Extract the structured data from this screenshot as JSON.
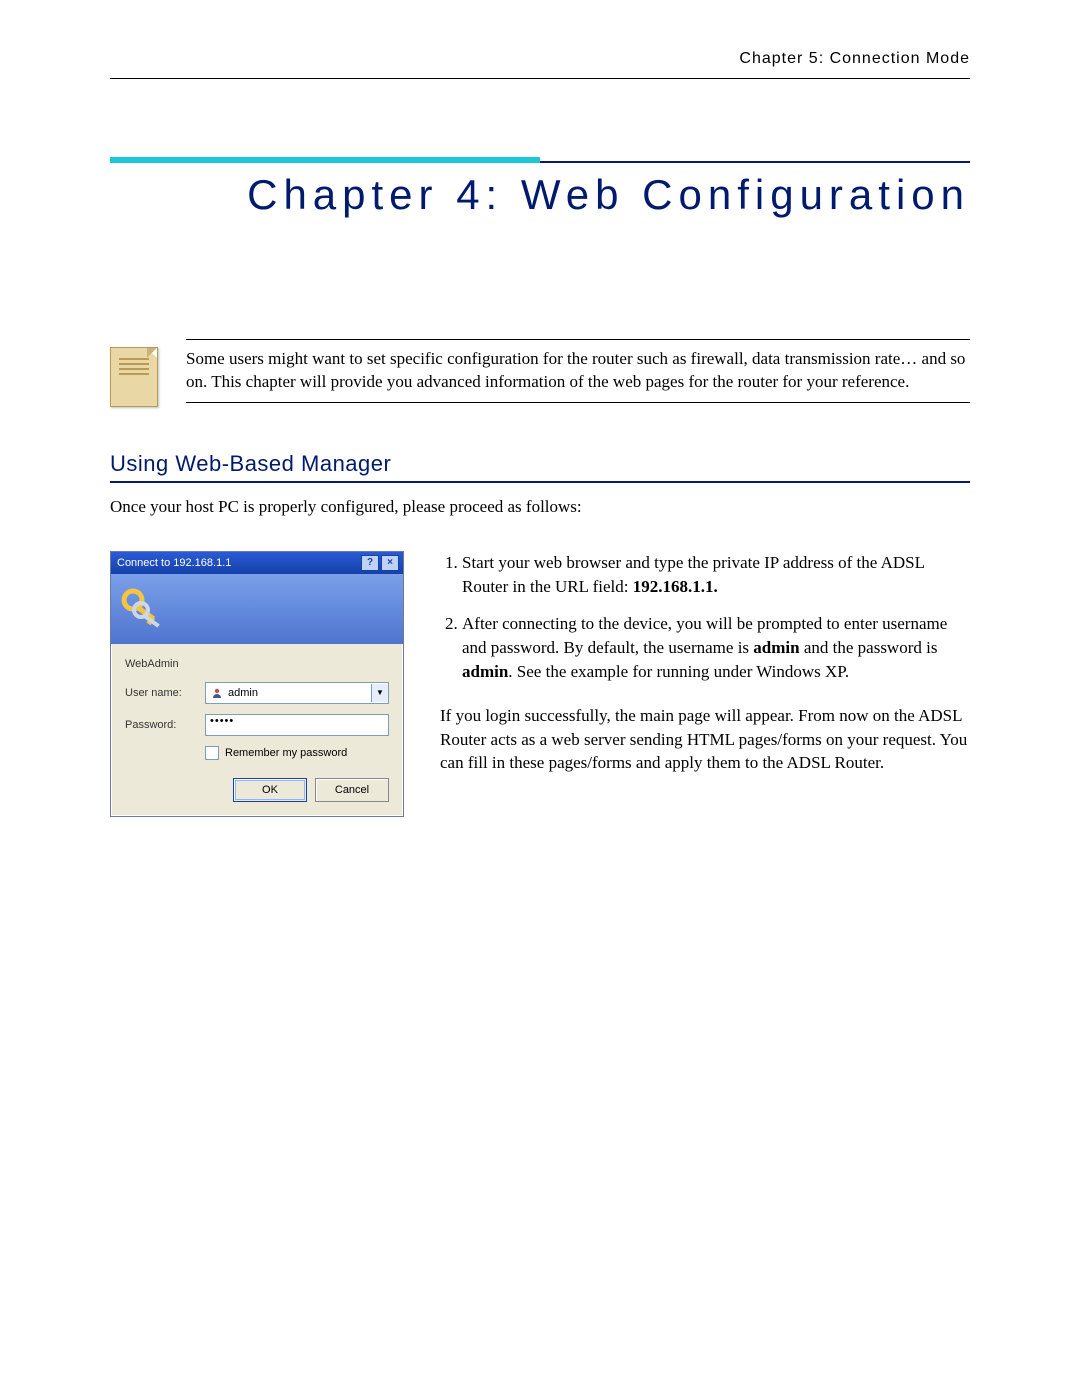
{
  "running_head": "Chapter 5: Connection Mode",
  "chapter_title": "Chapter 4: Web Configuration",
  "note_text": "Some users might want to set specific configuration for the router such as firewall, data transmission rate… and so on. This chapter will provide you advanced information of the web pages for the router for your reference.",
  "section_heading": "Using Web-Based Manager",
  "intro_text": "Once your host PC is properly configured, please proceed as follows:",
  "dialog": {
    "title": "Connect to 192.168.1.1",
    "realm": "WebAdmin",
    "username_label": "User name:",
    "username_value": "admin",
    "password_label": "Password:",
    "password_value": "•••••",
    "remember_label": "Remember my password",
    "ok": "OK",
    "cancel": "Cancel"
  },
  "step1_a": "Start your web browser and type the private IP address of the ADSL Router in the URL field: ",
  "step1_b": "192.168.1.1.",
  "step2_a": "After connecting to the device, you will be prompted to enter username and password. By default, the username is ",
  "step2_b": "admin",
  "step2_c": " and the password is ",
  "step2_d": "admin",
  "step2_e": ". See the example for running under Windows XP.",
  "success_para": "If you login successfully, the main page will appear. From now on the ADSL Router acts as a web server sending HTML pages/forms on your request. You can fill in these pages/forms and apply them to the ADSL Router."
}
